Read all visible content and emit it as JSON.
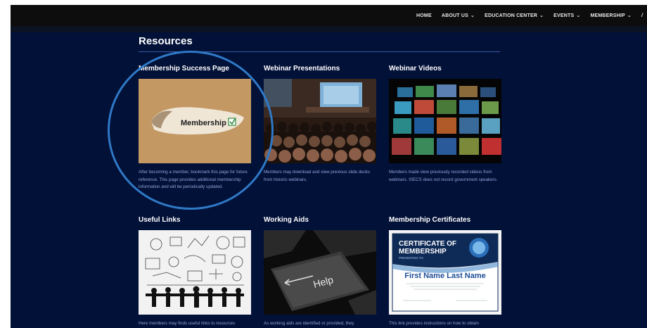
{
  "nav": {
    "items": [
      {
        "label": "HOME",
        "has_dropdown": false
      },
      {
        "label": "ABOUT US",
        "has_dropdown": true
      },
      {
        "label": "EDUCATION CENTER",
        "has_dropdown": true
      },
      {
        "label": "EVENTS",
        "has_dropdown": true
      },
      {
        "label": "MEMBERSHIP",
        "has_dropdown": true
      }
    ],
    "dropdown_icon": "chevron-down-icon"
  },
  "section": {
    "title": "Resources"
  },
  "cards": [
    {
      "title": "Membership Success Page",
      "image_label": "Membership",
      "description": "After becoming a member, bookmark this page for future reference. This page provides additional membership information and will be periodically updated."
    },
    {
      "title": "Webinar Presentations",
      "description": "Members may download and view previous slide decks from historic webinars."
    },
    {
      "title": "Webinar Videos",
      "description": "Members made view previously recorded videos from webinars. ISECS does not record government speakers."
    },
    {
      "title": "Useful Links",
      "description": "Here members may finds useful links to resources"
    },
    {
      "title": "Working Aids",
      "image_label": "Help",
      "description": "As working aids are identified or provided, they"
    },
    {
      "title": "Membership Certificates",
      "certificate": {
        "heading_line1": "CERTIFICATE OF",
        "heading_line2": "MEMBERSHIP",
        "presented_to": "PRESENTED TO",
        "name": "First Name Last Name"
      },
      "description": "This link provides instructions on how to obtain"
    }
  ],
  "colors": {
    "background": "#021138",
    "topbar": "#0d0d0d",
    "highlight_circle": "#2f79c7",
    "description_text": "#8ea6d4"
  }
}
